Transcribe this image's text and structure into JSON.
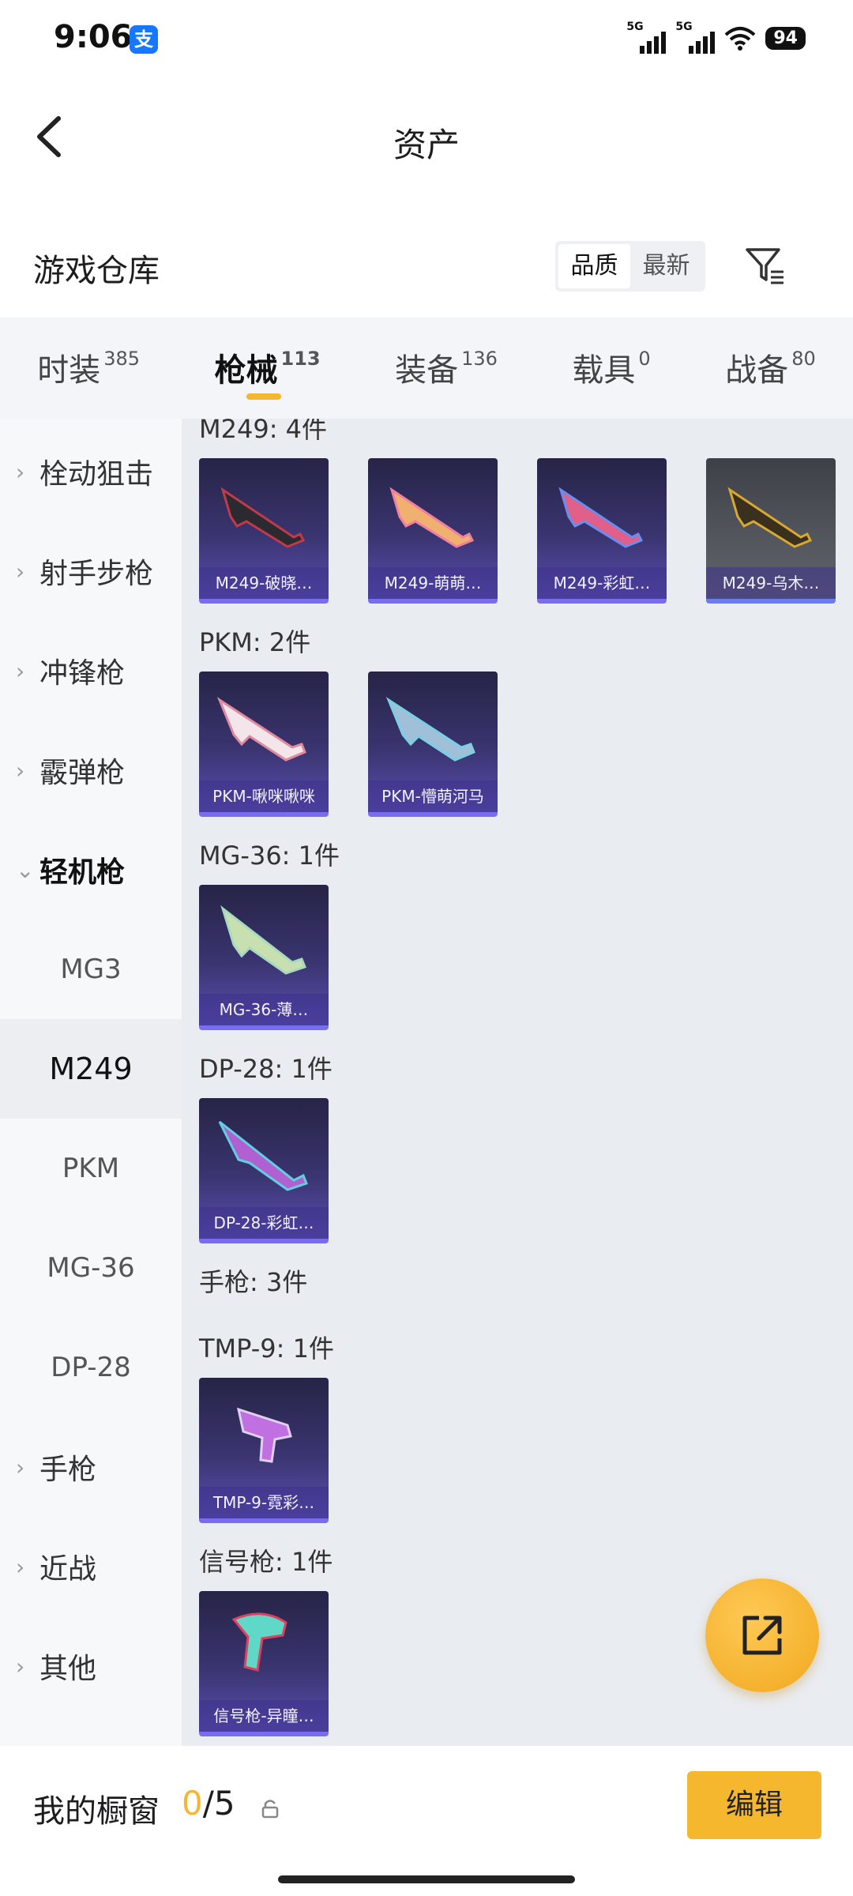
{
  "status_bar": {
    "time": "9:06",
    "app_icon": "支",
    "net1": "5G",
    "net2": "5G",
    "battery": "94"
  },
  "header": {
    "title": "资产"
  },
  "warehouse": {
    "title": "游戏仓库",
    "sort": {
      "quality": "品质",
      "latest": "最新"
    }
  },
  "tabs": [
    {
      "label": "时装",
      "count": "385"
    },
    {
      "label": "枪械",
      "count": "113"
    },
    {
      "label": "装备",
      "count": "136"
    },
    {
      "label": "载具",
      "count": "0"
    },
    {
      "label": "战备",
      "count": "80"
    }
  ],
  "sidebar": {
    "categories": [
      "栓动狙击",
      "射手步枪",
      "冲锋枪",
      "霰弹枪",
      "轻机枪"
    ],
    "subitems": [
      "MG3",
      "M249",
      "PKM",
      "MG-36",
      "DP-28"
    ],
    "more": [
      "手枪",
      "近战",
      "其他"
    ]
  },
  "groups": [
    {
      "label": "M249: 4件",
      "items": [
        "M249-破晓…",
        "M249-萌萌…",
        "M249-彩虹…",
        "M249-乌木…"
      ]
    },
    {
      "label": "PKM: 2件",
      "items": [
        "PKM-啾咪啾咪",
        "PKM-懵萌河马"
      ]
    },
    {
      "label": "MG-36: 1件",
      "items": [
        "MG-36-薄…"
      ]
    },
    {
      "label": "DP-28: 1件",
      "items": [
        "DP-28-彩虹…"
      ]
    },
    {
      "label": "手枪: 3件",
      "items": []
    },
    {
      "label": "TMP-9: 1件",
      "items": [
        "TMP-9-霓彩…"
      ]
    },
    {
      "label": "信号枪: 1件",
      "items": [
        "信号枪-异瞳…"
      ]
    }
  ],
  "bottom": {
    "title": "我的橱窗",
    "current": "0",
    "separator": "/",
    "total": "5",
    "edit": "编辑"
  },
  "colors": {
    "accent": "#f5b72e",
    "card_dark": "#2b2850",
    "card_gray": "#55575f"
  }
}
